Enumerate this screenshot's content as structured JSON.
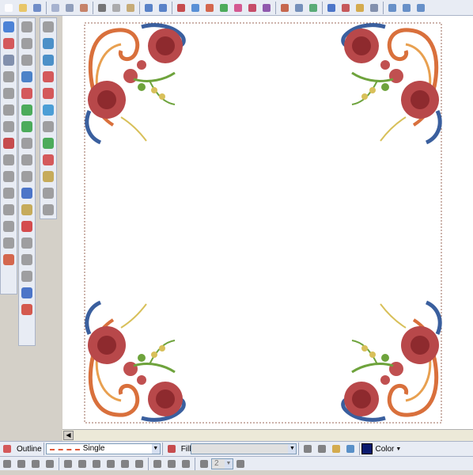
{
  "top_toolbar": {
    "icons": [
      "new-icon",
      "open-icon",
      "save-icon",
      "print-preview-icon",
      "print-icon",
      "hoop-icon",
      "cut-icon",
      "copy-icon",
      "paste-icon",
      "undo-icon",
      "redo-icon",
      "grid-icon",
      "select-icon",
      "stitch-icon",
      "color-icon",
      "wizard-icon",
      "travel-icon",
      "hide-icon",
      "show-icon",
      "align-icon",
      "zoom-in-icon",
      "zoom-out-icon",
      "zoom-fit-icon"
    ]
  },
  "property_bar": {
    "outline_label": "Outline",
    "line_style": "Single",
    "fill_label": "Fill",
    "color_label": "Color",
    "color_swatch": "#0a1a6e"
  },
  "bottom_toolbar": {
    "spacing_value": "2"
  },
  "colors": {
    "rose": "#b8484a",
    "rose_dark": "#8e2a2e",
    "scroll_orange": "#d9703c",
    "scroll_blue": "#3a5f9e",
    "leaf_green": "#6ea33c",
    "gold": "#d8c05a",
    "frame": "#9b6a5a"
  }
}
